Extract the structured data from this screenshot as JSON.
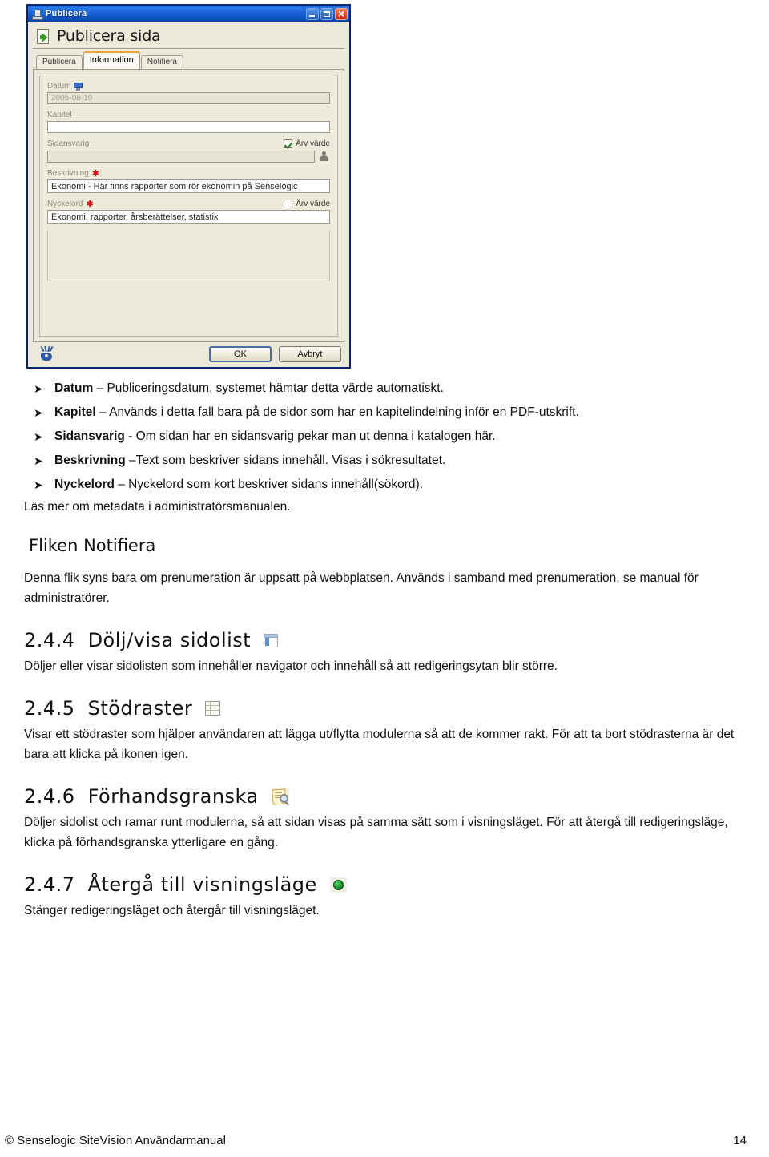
{
  "dialog": {
    "window_title": "Publicera",
    "window_icon": "publish-window-icon",
    "minimize_label": "Minimera",
    "maximize_label": "Maximera",
    "close_label": "Stäng",
    "header_title": "Publicera sida",
    "tabs": [
      {
        "label": "Publicera",
        "selected": false
      },
      {
        "label": "Information",
        "selected": true
      },
      {
        "label": "Notifiera",
        "selected": false
      }
    ],
    "fields": {
      "datum_label": "Datum",
      "datum_value": "2005-08-19",
      "kapitel_label": "Kapitel",
      "kapitel_value": "",
      "sidansvarig_label": "Sidansvarig",
      "sidansvarig_value": "",
      "sidansvarig_inherit_label": "Ärv värde",
      "beskrivning_label": "Beskrivning",
      "beskrivning_value": "Ekonomi - Här finns rapporter som rör ekonomin på Senselogic",
      "nyckelord_label": "Nyckelord",
      "nyckelord_value": "Ekonomi, rapporter, årsberättelser, statistik",
      "nyckelord_inherit_label": "Ärv värde"
    },
    "buttons": {
      "ok": "OK",
      "cancel": "Avbryt"
    }
  },
  "document": {
    "bullets": [
      {
        "term": "Datum",
        "rest": " – Publiceringsdatum, systemet hämtar detta värde automatiskt."
      },
      {
        "term": "Kapitel",
        "rest": " – Används i detta fall bara på de sidor som har en kapitelindelning inför en PDF-utskrift."
      },
      {
        "term": "Sidansvarig",
        "rest": " - Om sidan har en sidansvarig pekar man ut denna i katalogen här."
      },
      {
        "term": "Beskrivning",
        "rest": " –Text som beskriver sidans innehåll. Visas i sökresultatet."
      },
      {
        "term": "Nyckelord",
        "rest": " – Nyckelord som kort beskriver sidans innehåll(sökord)."
      }
    ],
    "after_bullets": "Läs mer om metadata i administratörsmanualen.",
    "fliken_heading": "Fliken Notifiera",
    "fliken_body": "Denna flik syns bara om prenumeration är uppsatt på webbplatsen. Används i samband med prenumeration, se manual för administratörer.",
    "sections": [
      {
        "number": "2.4.4",
        "title": "Dölj/visa sidolist",
        "icon": "sidebar-toggle-icon",
        "body": "Döljer eller visar sidolisten som innehåller navigator och innehåll så att redigeringsytan blir större."
      },
      {
        "number": "2.4.5",
        "title": "Stödraster",
        "icon": "grid-icon",
        "body": "Visar ett stödraster som hjälper användaren att lägga ut/flytta modulerna så att de kommer rakt. För att ta bort stödrasterna är det bara att klicka på ikonen igen."
      },
      {
        "number": "2.4.6",
        "title": "Förhandsgranska",
        "icon": "preview-magnifier-icon",
        "body": "Döljer sidolist och ramar runt modulerna, så att sidan visas på samma sätt som i visningsläget. För att återgå till redigeringsläge, klicka på förhandsgranska ytterligare en gång."
      },
      {
        "number": "2.4.7",
        "title": "Återgå till visningsläge",
        "icon": "green-globe-icon",
        "body": "Stänger redigeringsläget och återgår till visningsläget."
      }
    ]
  },
  "footer": {
    "copyright": "© Senselogic SiteVision Användarmanual",
    "page_number": "14"
  },
  "colors": {
    "titlebar_blue": "#1a62d8",
    "dialog_face": "#ece9d8",
    "tab_accent": "#e8a33d",
    "required_star": "#dd0000",
    "check_green": "#1d7a26"
  }
}
